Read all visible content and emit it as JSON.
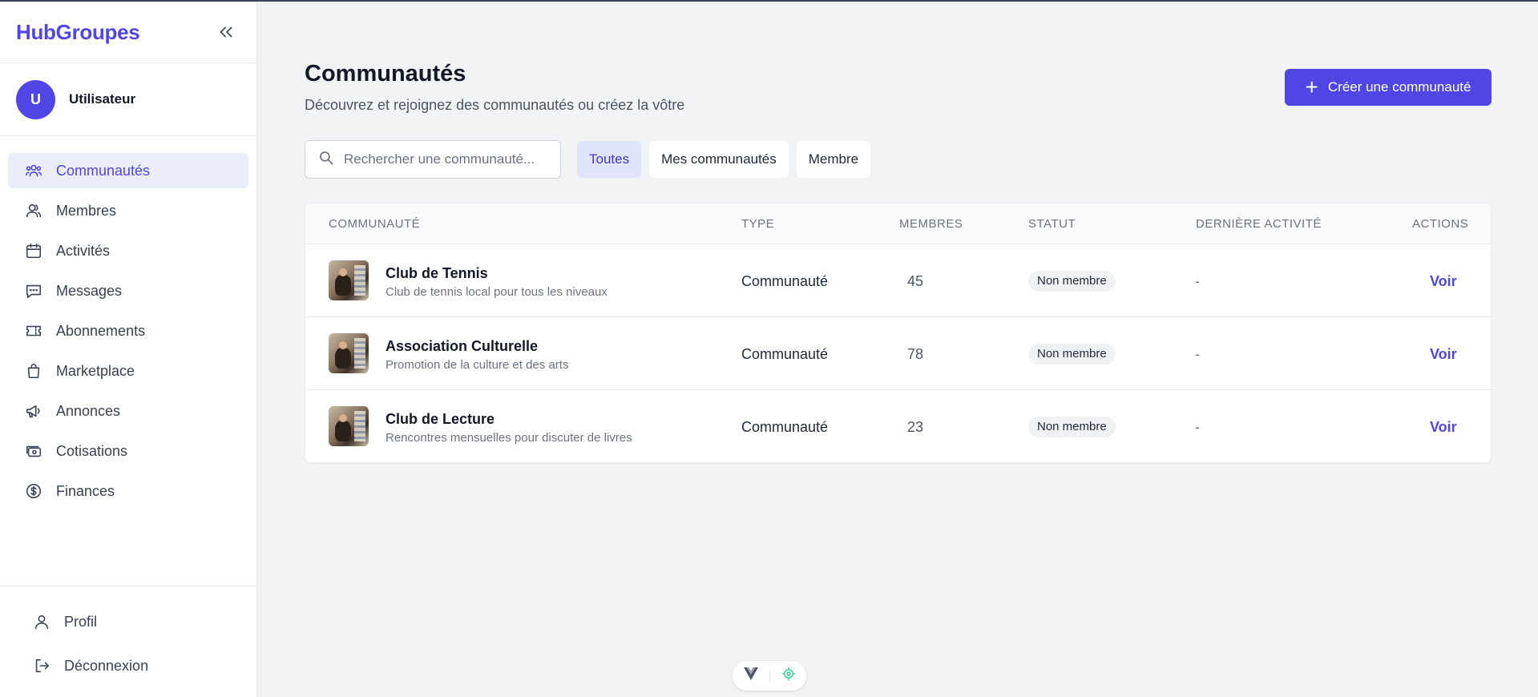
{
  "app": {
    "brand": "HubGroupes",
    "accent": "#4f46e5"
  },
  "user": {
    "initial": "U",
    "name": "Utilisateur"
  },
  "sidebar": {
    "items": [
      {
        "label": "Communautés",
        "icon": "users-group-icon",
        "active": true
      },
      {
        "label": "Membres",
        "icon": "members-icon"
      },
      {
        "label": "Activités",
        "icon": "calendar-icon"
      },
      {
        "label": "Messages",
        "icon": "chat-icon"
      },
      {
        "label": "Abonnements",
        "icon": "ticket-icon"
      },
      {
        "label": "Marketplace",
        "icon": "shopping-bag-icon"
      },
      {
        "label": "Annonces",
        "icon": "megaphone-icon"
      },
      {
        "label": "Cotisations",
        "icon": "cash-icon"
      },
      {
        "label": "Finances",
        "icon": "dollar-circle-icon"
      }
    ],
    "footer": [
      {
        "label": "Profil",
        "icon": "user-icon"
      },
      {
        "label": "Déconnexion",
        "icon": "logout-icon"
      }
    ]
  },
  "header": {
    "title": "Communautés",
    "subtitle": "Découvrez et rejoignez des communautés ou créez la vôtre",
    "create_label": "Créer une communauté"
  },
  "search": {
    "placeholder": "Rechercher une communauté...",
    "value": ""
  },
  "filters": [
    {
      "label": "Toutes",
      "active": true
    },
    {
      "label": "Mes communautés",
      "active": false
    },
    {
      "label": "Membre",
      "active": false
    }
  ],
  "table": {
    "columns": [
      "COMMUNAUTÉ",
      "TYPE",
      "MEMBRES",
      "STATUT",
      "DERNIÈRE ACTIVITÉ",
      "ACTIONS"
    ],
    "rows": [
      {
        "name": "Club de Tennis",
        "description": "Club de tennis local pour tous les niveaux",
        "type": "Communauté",
        "members": "45",
        "status": "Non membre",
        "last_activity": "-",
        "action": "Voir"
      },
      {
        "name": "Association Culturelle",
        "description": "Promotion de la culture et des arts",
        "type": "Communauté",
        "members": "78",
        "status": "Non membre",
        "last_activity": "-",
        "action": "Voir"
      },
      {
        "name": "Club de Lecture",
        "description": "Rencontres mensuelles pour discuter de livres",
        "type": "Communauté",
        "members": "23",
        "status": "Non membre",
        "last_activity": "-",
        "action": "Voir"
      }
    ]
  }
}
